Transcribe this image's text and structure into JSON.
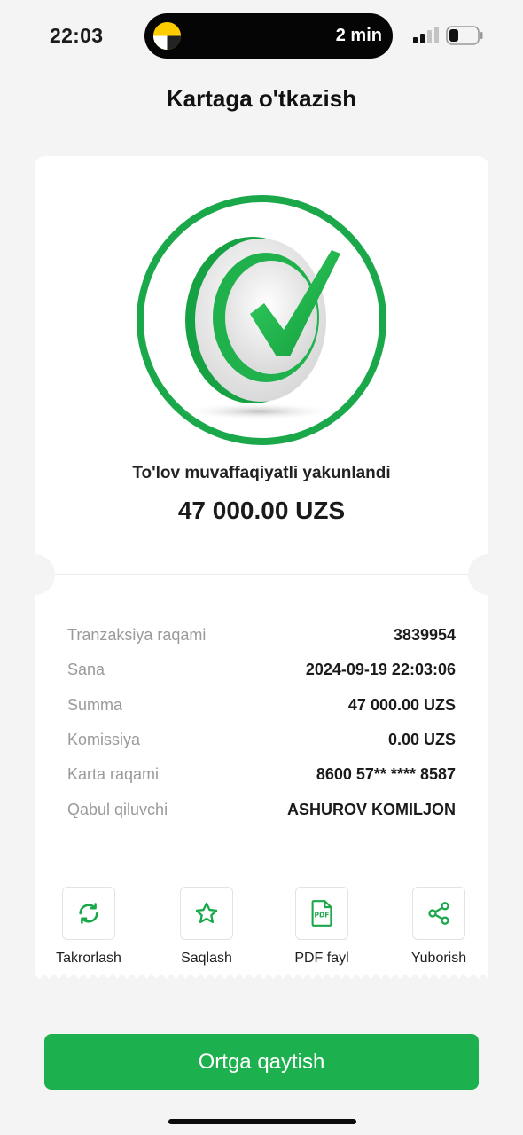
{
  "status_bar": {
    "time": "22:03",
    "island_text": "2 min",
    "signal_icon": "cellular-signal-icon",
    "battery_icon": "battery-low-icon"
  },
  "header": {
    "title": "Kartaga o'tkazish"
  },
  "receipt": {
    "status_text": "To'lov muvaffaqiyatli yakunlandi",
    "amount": "47 000.00 UZS",
    "details": [
      {
        "label": "Tranzaksiya raqami",
        "value": "3839954"
      },
      {
        "label": "Sana",
        "value": "2024-09-19 22:03:06"
      },
      {
        "label": "Summa",
        "value": "47 000.00 UZS"
      },
      {
        "label": "Komissiya",
        "value": "0.00 UZS"
      },
      {
        "label": "Karta raqami",
        "value": "8600 57** **** 8587"
      },
      {
        "label": "Qabul qiluvchi",
        "value": "ASHUROV KOMILJON"
      }
    ]
  },
  "actions": [
    {
      "label": "Takrorlash",
      "icon": "repeat-icon"
    },
    {
      "label": "Saqlash",
      "icon": "star-icon"
    },
    {
      "label": "PDF fayl",
      "icon": "pdf-file-icon"
    },
    {
      "label": "Yuborish",
      "icon": "share-icon"
    }
  ],
  "footer": {
    "back_label": "Ortga qaytish"
  },
  "colors": {
    "accent": "#1db04e",
    "background": "#f4f4f4",
    "card": "#ffffff"
  }
}
